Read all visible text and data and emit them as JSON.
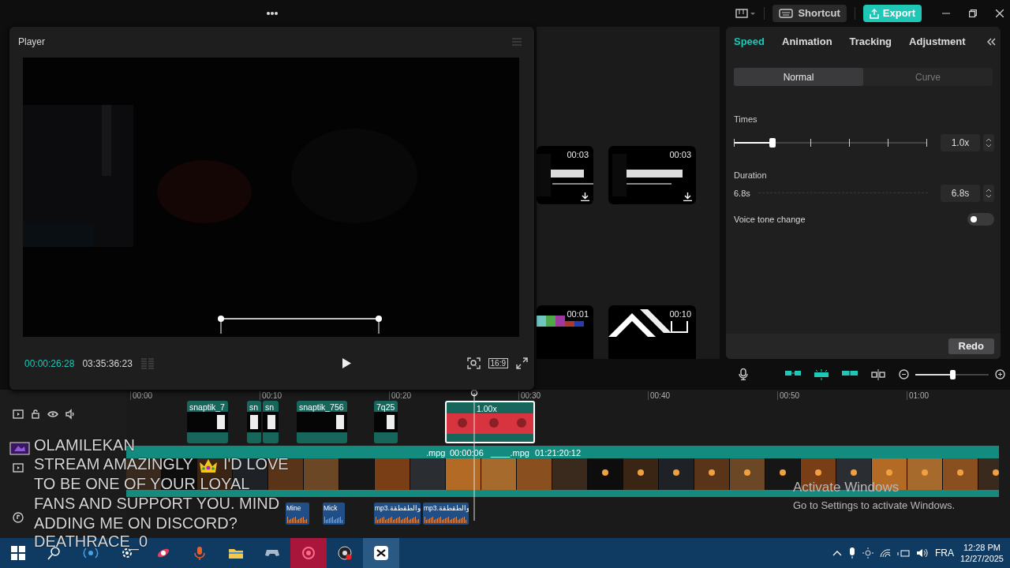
{
  "topbar": {
    "shortcut": "Shortcut",
    "export": "Export"
  },
  "player": {
    "title": "Player",
    "current_time": "00:00:26:28",
    "total_time": "03:35:36:23",
    "ratio": "16:9"
  },
  "media": {
    "templates": [
      {
        "duration": "00:03"
      },
      {
        "duration": "00:03"
      },
      {
        "duration": "00:01"
      },
      {
        "duration": "00:10"
      }
    ]
  },
  "properties": {
    "tabs": [
      {
        "label": "Speed",
        "selected": true
      },
      {
        "label": "Animation",
        "selected": false
      },
      {
        "label": "Tracking",
        "selected": false
      },
      {
        "label": "Adjustment",
        "selected": false
      }
    ],
    "modes": [
      {
        "label": "Normal",
        "selected": true
      },
      {
        "label": "Curve",
        "selected": false
      }
    ],
    "times": {
      "label": "Times",
      "level": 0.2,
      "value": "1.0x"
    },
    "duration": {
      "label": "Duration",
      "min": "6.8s",
      "value": "6.8s",
      "disabled": true
    },
    "voice_tone": {
      "label": "Voice tone change",
      "on": false
    },
    "redo": "Redo"
  },
  "timeline": {
    "zoom": {
      "level": 0.5
    },
    "ruler": [
      "00:00",
      "00:10",
      "00:20",
      "00:30",
      "00:40",
      "00:50",
      "01:00"
    ],
    "clips": [
      {
        "name": "snaptik_7",
        "selected": false
      },
      {
        "name": "sn",
        "selected": false
      },
      {
        "name": "sn",
        "selected": false
      },
      {
        "name": "snaptik_756",
        "selected": false
      },
      {
        "name": "7q25",
        "selected": false
      },
      {
        "name": "1.00x",
        "selected": true
      }
    ],
    "main_clips": [
      {
        "name": ".mpg",
        "time": "00:00:06"
      },
      {
        "name": "____.mpg",
        "time": "01:21:20:12"
      }
    ],
    "audio_clips": [
      {
        "name": "Mine"
      },
      {
        "name": "Mick"
      },
      {
        "name": "mp3.والطقطقة"
      },
      {
        "name": "mp3.والطقطقة"
      }
    ]
  },
  "chat_overlay": {
    "user": "OLAMILEKAN",
    "message_start": "STREAM AMAZINGLY",
    "message_lines": [
      "I'D LOVE",
      "TO BE ONE OF YOUR LOYAL",
      "FANS AND SUPPORT YOU. MIND",
      "ADDING ME ON DISCORD?"
    ],
    "signature": "DEATHRACE_0"
  },
  "activation": {
    "title": "Activate Windows",
    "hint": "Go to Settings to activate Windows."
  },
  "taskbar": {
    "language": "FRA",
    "time": "12:28 PM",
    "date": "12/27/2025"
  }
}
